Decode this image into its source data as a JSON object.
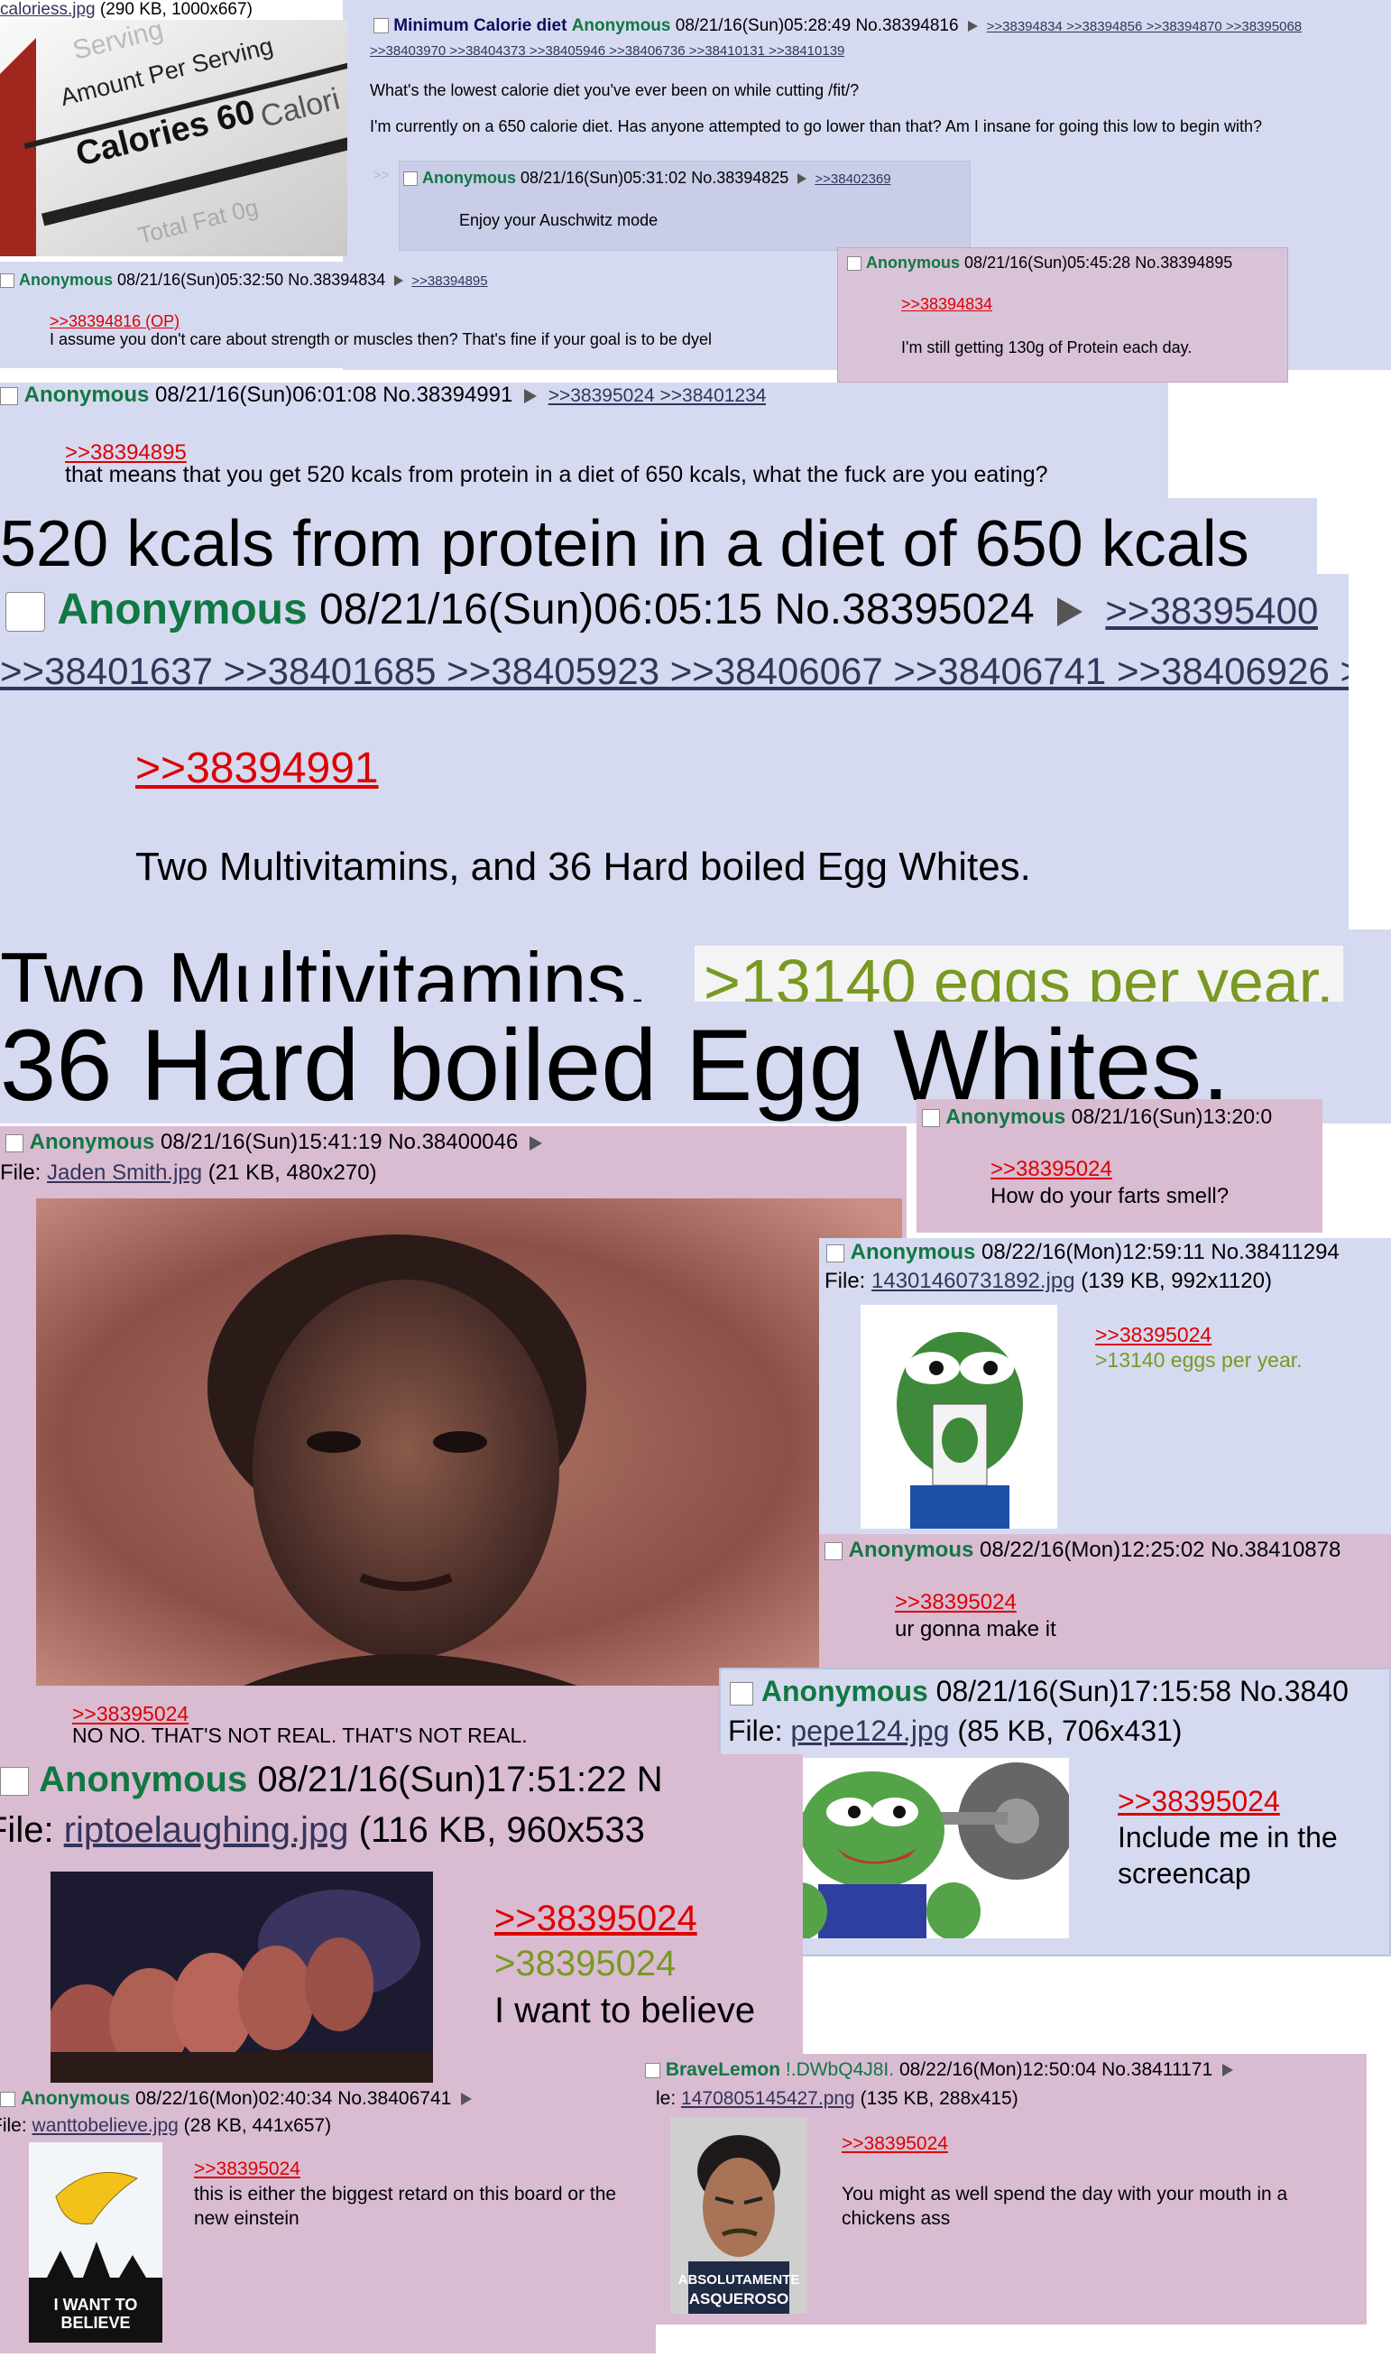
{
  "op": {
    "file_link": "caloriess.jpg",
    "file_info": "(290 KB, 1000x667)",
    "label_amount": "Amount Per Serving",
    "label_calories": "Calories 60",
    "label_calori": "Calori",
    "label_fat": "Total Fat 0g",
    "label_serving": "Serving",
    "subject": "Minimum Calorie diet",
    "name": "Anonymous",
    "datetime": "08/21/16(Sun)05:28:49",
    "no": "No.38394816",
    "backlinks_1": ">>38394834 >>38394856 >>38394870 >>38395068",
    "backlinks_2": ">>38403970 >>38404373 >>38405946 >>38406736 >>38410131 >>38410139",
    "body_1": "What's the lowest calorie diet you've ever been on while cutting /fit/?",
    "body_2": "I'm currently on a 650 calorie diet. Has anyone attempted to go lower than that? Am I insane for going this low to begin with?"
  },
  "reply_4825": {
    "arrows": ">>",
    "name": "Anonymous",
    "datetime": "08/21/16(Sun)05:31:02",
    "no": "No.38394825",
    "backlink": ">>38402369",
    "body": "Enjoy your Auschwitz mode"
  },
  "reply_4834": {
    "name": "Anonymous",
    "datetime": "08/21/16(Sun)05:32:50",
    "no": "No.38394834",
    "backlink": ">>38394895",
    "quote": ">>38394816 (OP)",
    "body": "I assume you don't care about strength or muscles then? That's fine if your goal is to be dyel"
  },
  "reply_4895": {
    "name": "Anonymous",
    "datetime": "08/21/16(Sun)05:45:28",
    "no": "No.38394895",
    "quote": ">>38394834",
    "body": "I'm still getting 130g of Protein each day."
  },
  "reply_4991": {
    "name": "Anonymous",
    "datetime": "08/21/16(Sun)06:01:08",
    "no": "No.38394991",
    "backlinks": ">>38395024 >>38401234",
    "quote": ">>38394895",
    "body": "that means that you get 520 kcals from protein in a diet of 650 kcals, what the fuck are you eating?"
  },
  "zoom_1": "520 kcals from protein in a diet of 650 kcals",
  "reply_5024": {
    "name": "Anonymous",
    "datetime": "08/21/16(Sun)06:05:15",
    "no": "No.38395024",
    "backlinks_1": ">>38395400",
    "backlinks_2": ">>38401637 >>38401685 >>38405923 >>38406067 >>38406741 >>38406926 >",
    "quote": ">>38394991",
    "body": "Two Multivitamins, and 36 Hard boiled Egg Whites."
  },
  "zoom_2": "Two Multivitamins,",
  "zoom_2_green": ">13140 eggs per year.",
  "zoom_3": "36 Hard boiled Egg Whites.",
  "reply_farts": {
    "name": "Anonymous",
    "datetime": "08/21/16(Sun)13:20:0",
    "quote": ">>38395024",
    "body": "How do your farts smell?"
  },
  "reply_jaden": {
    "name": "Anonymous",
    "datetime": "08/21/16(Sun)15:41:19",
    "no": "No.38400046",
    "file_prefix": "File:",
    "file_link": "Jaden Smith.jpg",
    "file_info": "(21 KB, 480x270)",
    "quote": ">>38395024",
    "body": "NO NO. THAT'S NOT REAL. THAT'S NOT REAL."
  },
  "reply_pepehood": {
    "name": "Anonymous",
    "datetime": "08/22/16(Mon)12:59:11",
    "no": "No.38411294",
    "file_prefix": "File:",
    "file_link": "14301460731892.jpg",
    "file_info": "(139 KB, 992x1120)",
    "quote": ">>38395024",
    "greentext": ">13140 eggs per year."
  },
  "reply_make": {
    "name": "Anonymous",
    "datetime": "08/22/16(Mon)12:25:02",
    "no": "No.38410878",
    "quote": ">>38395024",
    "body": "ur gonna make it"
  },
  "reply_pepe124": {
    "name": "Anonymous",
    "datetime": "08/21/16(Sun)17:15:58",
    "no": "No.3840",
    "file_prefix": "File:",
    "file_link": "pepe124.jpg",
    "file_info": "(85 KB, 706x431)",
    "quote": ">>38395024",
    "body_1": "Include me in the",
    "body_2": "screencap"
  },
  "reply_believe": {
    "name": "Anonymous",
    "datetime": "08/21/16(Sun)17:51:22",
    "no": "N",
    "file_prefix": "File:",
    "file_link": "riptoelaughing.jpg",
    "file_info": "(116 KB, 960x533",
    "quote": ">>38395024",
    "greentext": ">38395024",
    "body": "I want to believe"
  },
  "reply_einstein": {
    "name": "Anonymous",
    "datetime": "08/22/16(Mon)02:40:34",
    "no": "No.38406741",
    "file_prefix": "File:",
    "file_link": "wanttobelieve.jpg",
    "file_info": "(28 KB, 441x657)",
    "poster_text": "I WANT TO BELIEVE",
    "quote": ">>38395024",
    "body": "this is either the biggest retard on this board or the new einstein"
  },
  "reply_lemon": {
    "name": "BraveLemon",
    "trip": "!.DWbQ4J8I.",
    "datetime": "08/22/16(Mon)12:50:04",
    "no": "No.38411171",
    "file_prefix": "le:",
    "file_link": "1470805145427.png",
    "file_info": "(135 KB, 288x415)",
    "caption_1": "ABSOLUTAMENTE",
    "caption_2": "ASQUEROSO",
    "quote": ">>38395024",
    "body": "You might as well spend the day with your mouth in a chickens ass"
  }
}
